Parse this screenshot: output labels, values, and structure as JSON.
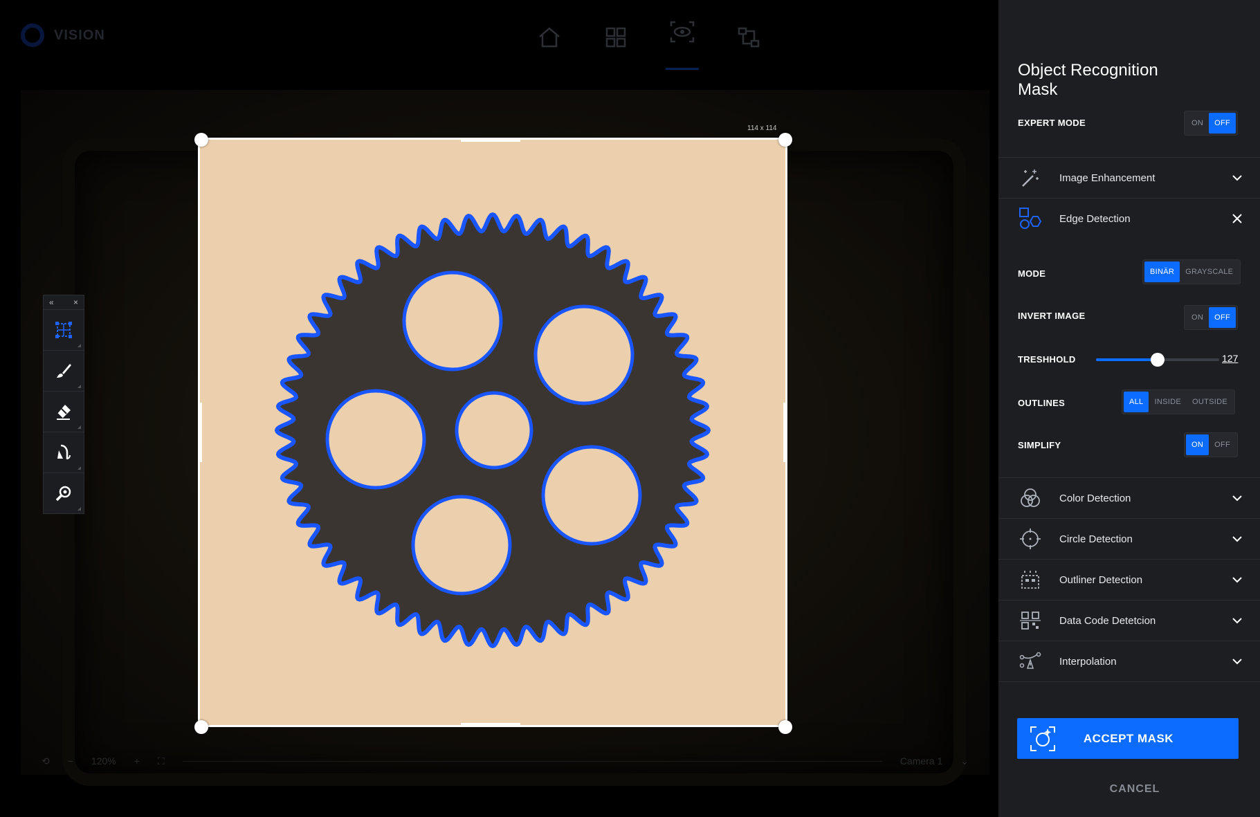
{
  "app": {
    "name": "VISION"
  },
  "nav": {
    "items": [
      "home-icon",
      "grid-icon",
      "eye-scan-icon",
      "flow-icon"
    ],
    "active": "eye-scan-icon"
  },
  "canvas": {
    "size_label": "114 x 114",
    "zoom": "120%",
    "camera": "Camera 1"
  },
  "toolbar": {
    "collapse_glyph": "«",
    "close_glyph": "×"
  },
  "panel": {
    "title_line1": "Object Recognition",
    "title_line2": "Mask",
    "expert_mode": {
      "label": "EXPERT MODE",
      "on": "ON",
      "off": "OFF",
      "value": "OFF"
    },
    "sections": {
      "image_enhancement": "Image Enhancement",
      "edge_detection": "Edge Detection",
      "color_detection": "Color Detection",
      "circle_detection": "Circle Detection",
      "outliner_detection": "Outliner Detection",
      "data_code_detection": "Data Code Detetcion",
      "interpolation": "Interpolation"
    },
    "edge": {
      "mode": {
        "label": "MODE",
        "options": [
          "BINÄR",
          "GRAYSCALE"
        ],
        "value": "BINÄR"
      },
      "invert": {
        "label": "INVERT IMAGE",
        "on": "ON",
        "off": "OFF",
        "value": "OFF"
      },
      "threshold": {
        "label": "TRESHHOLD",
        "value": "127",
        "fraction": 0.5
      },
      "outlines": {
        "label": "OUTLINES",
        "options": [
          "ALL",
          "INSIDE",
          "OUTSIDE"
        ],
        "value": "ALL"
      },
      "simplify": {
        "label": "SIMPLIFY",
        "on": "ON",
        "off": "OFF",
        "value": "ON"
      }
    },
    "accept": "ACCEPT MASK",
    "cancel": "CANCEL"
  },
  "colors": {
    "accent": "#0c6cff",
    "mask_bg": "#ecd0ad",
    "outline": "#1a56ff",
    "gear": "#3a3530"
  }
}
